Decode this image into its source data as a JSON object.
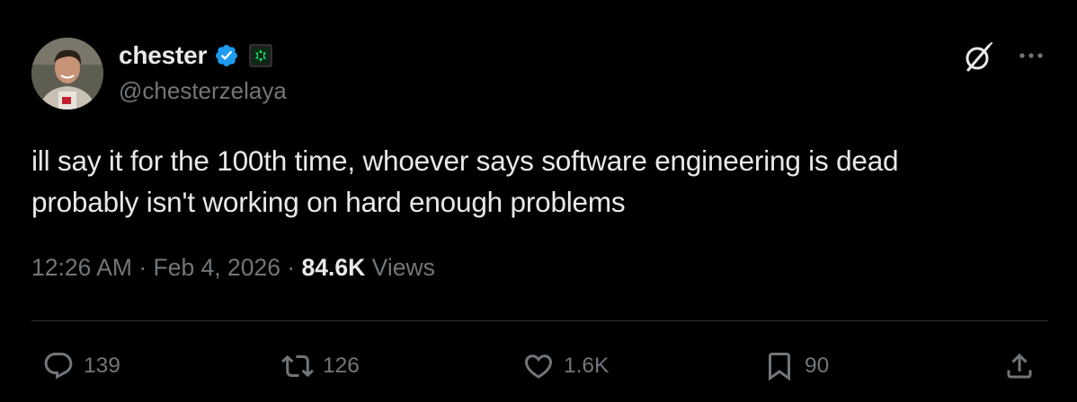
{
  "author": {
    "display_name": "chester",
    "handle": "@chesterzelaya",
    "verified": true
  },
  "tweet": {
    "text": "ill say it for the 100th time, whoever says software engineering is dead\nprobably isn't working on hard enough problems"
  },
  "meta": {
    "time": "12:26 AM",
    "separator": " · ",
    "date": "Feb 4, 2026",
    "views_count": "84.6K",
    "views_label": " Views"
  },
  "actions": {
    "replies": "139",
    "reposts": "126",
    "likes": "1.6K",
    "bookmarks": "90"
  },
  "colors": {
    "background": "#000000",
    "text_primary": "#e7e9ea",
    "text_secondary": "#71767b",
    "verified_blue": "#1d9bf0",
    "affiliation_green": "#00ba7c",
    "divider": "#2f3336"
  },
  "icons": {
    "verified": "verified-badge-icon",
    "affiliation": "affiliation-badge-icon",
    "grok": "grok-icon",
    "more": "more-icon",
    "reply": "reply-icon",
    "repost": "repost-icon",
    "like": "like-icon",
    "bookmark": "bookmark-icon",
    "share": "share-icon"
  }
}
